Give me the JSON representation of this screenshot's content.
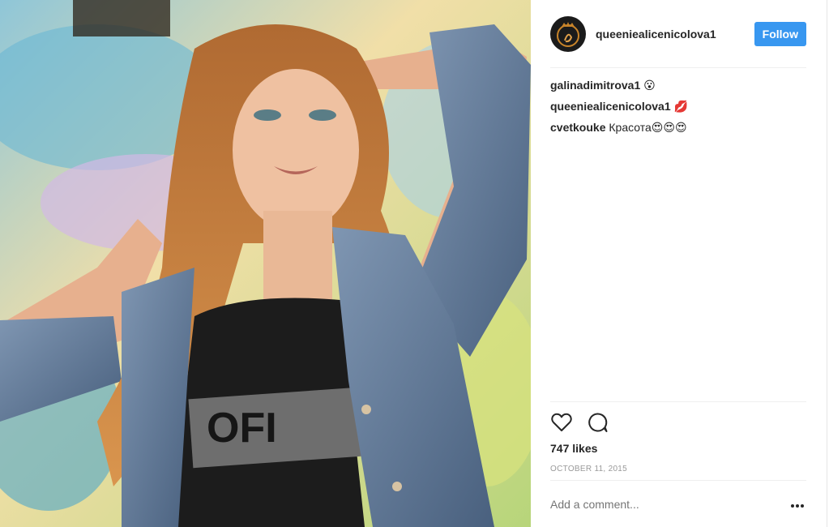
{
  "post": {
    "username": "queeniealicenicolova1",
    "follow_label": "Follow",
    "comments": [
      {
        "author": "galinadimitrova1",
        "text": "😮"
      },
      {
        "author": "queeniealicenicolova1",
        "text": "💋"
      },
      {
        "author": "cvetkouke",
        "text": "Красота😍😍😍"
      }
    ],
    "likes_text": "747 likes",
    "date_text": "OCTOBER 11, 2015",
    "add_comment_placeholder": "Add a comment...",
    "photo_shirt_text": "OFI"
  },
  "icons": {
    "like": "heart-icon",
    "comment": "comment-bubble-icon",
    "more": "more-options-icon"
  },
  "colors": {
    "follow_button": "#3897f0",
    "text": "#262626",
    "muted": "#999999"
  }
}
